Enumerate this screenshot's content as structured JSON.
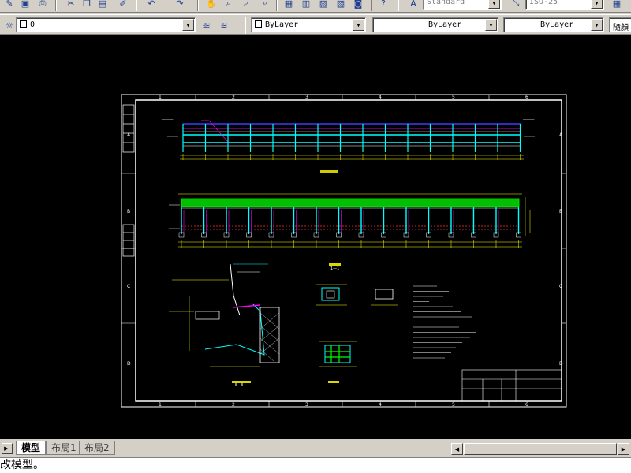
{
  "toolbar": {
    "text_style": "Standard",
    "dim_style": "ISO-25"
  },
  "layers": {
    "current_layer": "0",
    "color": "ByLayer",
    "linetype": "ByLayer",
    "lineweight": "ByLayer",
    "plot_style": "隨顏"
  },
  "tabs": [
    {
      "label": "模型",
      "active": true
    },
    {
      "label": "布局1",
      "active": false
    },
    {
      "label": "布局2",
      "active": false
    }
  ],
  "command_line": {
    "text": "改模型。"
  },
  "drawing": {
    "border_rows": [
      "A",
      "B",
      "C",
      "D"
    ],
    "border_cols": [
      "1",
      "2",
      "3",
      "4",
      "5",
      "6"
    ],
    "view_labels": [
      "1—1",
      "Ⅱ—Ⅱ"
    ],
    "colors": {
      "background": "#000000",
      "border": "#ffffff",
      "deck": "#00ff00",
      "beam": "#3b3bff",
      "pier": "#00ffff",
      "dimension": "#ffff00",
      "accent": "#ff00ff",
      "hatch": "#ff3333"
    }
  }
}
